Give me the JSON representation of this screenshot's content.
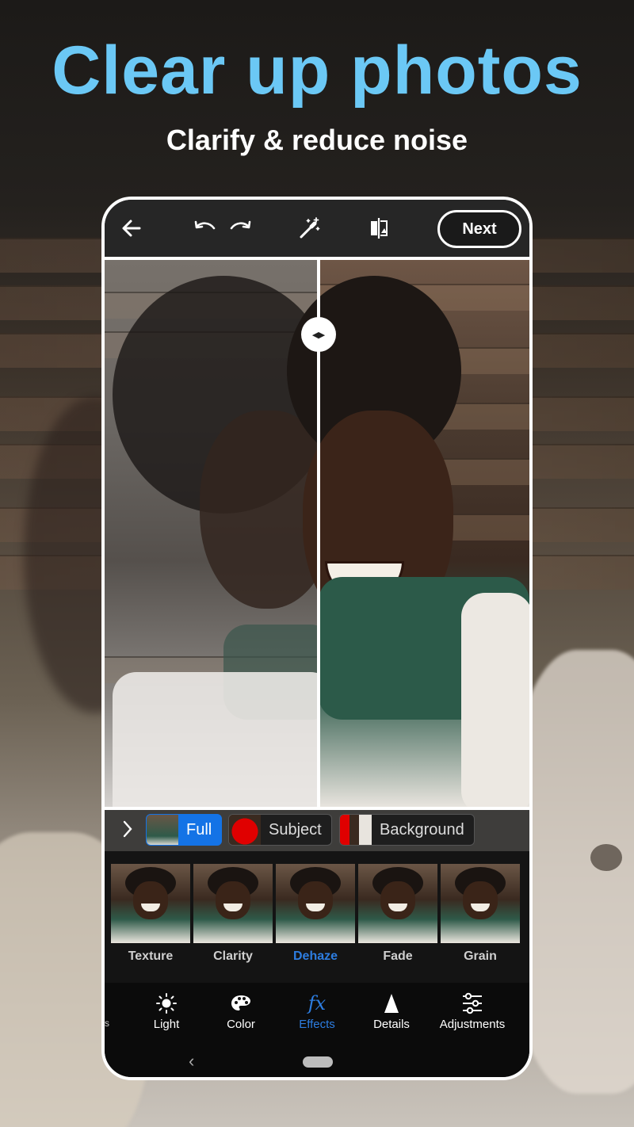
{
  "promo": {
    "headline": "Clear up photos",
    "subhead": "Clarify & reduce noise"
  },
  "toolbar": {
    "back_icon": "arrow-left-icon",
    "undo_icon": "undo-icon",
    "redo_icon": "redo-icon",
    "auto_icon": "magic-wand-icon",
    "compare_icon": "compare-icon",
    "next_label": "Next"
  },
  "masks": [
    {
      "label": "Full",
      "active": true,
      "thumb": "photo"
    },
    {
      "label": "Subject",
      "active": false,
      "thumb": "red-subject"
    },
    {
      "label": "Background",
      "active": false,
      "thumb": "red-background"
    }
  ],
  "filters": [
    {
      "label": "Texture",
      "active": false
    },
    {
      "label": "Clarity",
      "active": false
    },
    {
      "label": "Dehaze",
      "active": true
    },
    {
      "label": "Fade",
      "active": false
    },
    {
      "label": "Grain",
      "active": false
    }
  ],
  "tabs": [
    {
      "label": "Light",
      "icon": "sun-icon",
      "active": false
    },
    {
      "label": "Color",
      "icon": "palette-icon",
      "active": false
    },
    {
      "label": "Effects",
      "icon": "fx-icon",
      "active": true
    },
    {
      "label": "Details",
      "icon": "triangle-icon",
      "active": false
    },
    {
      "label": "Adjustments",
      "icon": "sliders-icon",
      "active": false
    }
  ],
  "tab_fragment": "s",
  "colors": {
    "headline": "#6bc8f5",
    "accent": "#1473e6",
    "active_text": "#2d7de0"
  }
}
